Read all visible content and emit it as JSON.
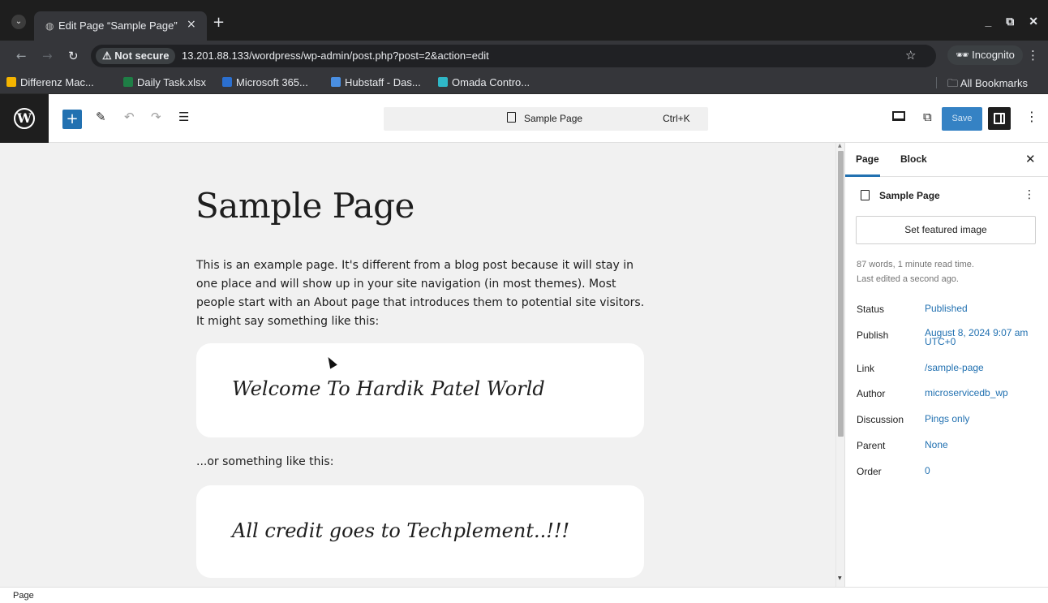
{
  "browser": {
    "tab_title": "Edit Page “Sample Page”",
    "close_icon": "×",
    "new_tab_icon": "+",
    "security_label": "⚠ Not secure",
    "url": "13.201.88.133/wordpress/wp-admin/post.php?post=2&action=edit",
    "incognito_label": "Incognito",
    "bookmarks": [
      {
        "label": "Differenz Mac...",
        "color": "#f4b400"
      },
      {
        "label": "Daily Task.xlsx",
        "color": "#1e7e45"
      },
      {
        "label": "Microsoft 365...",
        "color": "#2b6fcf"
      },
      {
        "label": "Hubstaff - Das...",
        "color": "#4a8fe2"
      },
      {
        "label": "Omada Contro...",
        "color": "#2fb7c7"
      }
    ],
    "all_bookmarks_label": "All Bookmarks"
  },
  "editor": {
    "command_title": "Sample Page",
    "command_shortcut": "Ctrl+K",
    "save_label": "Save",
    "accent_color": "#2271b1"
  },
  "content": {
    "title": "Sample Page",
    "intro": "This is an example page. It's different from a blog post because it will stay in one place and will show up in your site navigation (in most themes). Most people start with an About page that introduces them to potential site visitors. It might say something like this:",
    "quote1": "Welcome To Hardik Patel World",
    "or_text": "...or something like this:",
    "quote2": "All credit goes to Techplement..!!!"
  },
  "sidebar": {
    "tab_page": "Page",
    "tab_block": "Block",
    "doc_title": "Sample Page",
    "featured_image_label": "Set featured image",
    "word_count": "87 words, 1 minute read time.",
    "last_edited": "Last edited a second ago.",
    "rows": [
      {
        "label": "Status",
        "value": "Published"
      },
      {
        "label": "Publish",
        "value": "August 8, 2024 9:07 am UTC+0"
      },
      {
        "label": "Link",
        "value": "/sample-page"
      },
      {
        "label": "Author",
        "value": "microservicedb_wp"
      },
      {
        "label": "Discussion",
        "value": "Pings only"
      },
      {
        "label": "Parent",
        "value": "None"
      },
      {
        "label": "Order",
        "value": "0"
      }
    ]
  },
  "statusbar": {
    "breadcrumb": "Page"
  }
}
